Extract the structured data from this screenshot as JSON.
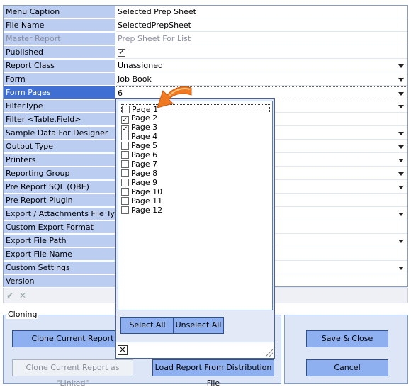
{
  "properties": [
    {
      "label": "Menu Caption",
      "value": "Selected Prep Sheet",
      "dropdown": false
    },
    {
      "label": "File Name",
      "value": "SelectedPrepSheet",
      "dropdown": false
    },
    {
      "label": "Master Report",
      "value": "Prep Sheet For List",
      "dropdown": false,
      "disabled": true
    },
    {
      "label": "Published",
      "value": "",
      "checkbox": true,
      "checked": true
    },
    {
      "label": "Report Class",
      "value": "Unassigned",
      "dropdown": true
    },
    {
      "label": "Form",
      "value": "Job Book",
      "dropdown": true
    },
    {
      "label": "Form Pages",
      "value": "6",
      "dropdown": true,
      "selected": true
    },
    {
      "label": "FilterType",
      "value": "",
      "dropdown": true
    },
    {
      "label": "Filter <Table.Field>",
      "value": "",
      "dropdown": false
    },
    {
      "label": "Sample Data For Designer",
      "value": "",
      "dropdown": true
    },
    {
      "label": "Output Type",
      "value": "",
      "dropdown": true
    },
    {
      "label": "Printers",
      "value": "",
      "dropdown": true
    },
    {
      "label": "Reporting Group",
      "value": "",
      "dropdown": true
    },
    {
      "label": "Pre Report SQL (QBE)",
      "value": "",
      "dropdown": true
    },
    {
      "label": "Pre Report Plugin",
      "value": "",
      "dropdown": false
    },
    {
      "label": "Export / Attachments File Type",
      "value": "",
      "dropdown": true
    },
    {
      "label": "Custom Export Format",
      "value": "",
      "dropdown": false
    },
    {
      "label": "Export File Path",
      "value": "",
      "dropdown": true
    },
    {
      "label": "Export File Name",
      "value": "",
      "dropdown": false
    },
    {
      "label": "Custom Settings",
      "value": "",
      "dropdown": true
    },
    {
      "label": "Version",
      "value": "",
      "dropdown": false
    }
  ],
  "toolbar": {
    "confirm_icon": "✔",
    "cancel_icon": "✕"
  },
  "cloning": {
    "title": "Cloning",
    "clone_current": "Clone Current Report",
    "clone_linked": "Clone Current Report as \"Linked\"",
    "load_distribution": "Load Report From Distribution File"
  },
  "actions": {
    "save_close": "Save & Close",
    "cancel": "Cancel"
  },
  "popup": {
    "pages": [
      {
        "label": "Page 1",
        "checked": false
      },
      {
        "label": "Page 2",
        "checked": true
      },
      {
        "label": "Page 3",
        "checked": true
      },
      {
        "label": "Page 4",
        "checked": false
      },
      {
        "label": "Page 5",
        "checked": false
      },
      {
        "label": "Page 6",
        "checked": false
      },
      {
        "label": "Page 7",
        "checked": false
      },
      {
        "label": "Page 8",
        "checked": false
      },
      {
        "label": "Page 9",
        "checked": false
      },
      {
        "label": "Page 10",
        "checked": false
      },
      {
        "label": "Page 11",
        "checked": false
      },
      {
        "label": "Page 12",
        "checked": false
      }
    ],
    "select_all": "Select All",
    "unselect_all": "Unselect All",
    "close_glyph": "✕"
  },
  "colors": {
    "label_bg": "#bccdf2",
    "selected_bg": "#3f6fd2",
    "button_bg": "#8fb0f0",
    "arrow": "#f07820"
  }
}
